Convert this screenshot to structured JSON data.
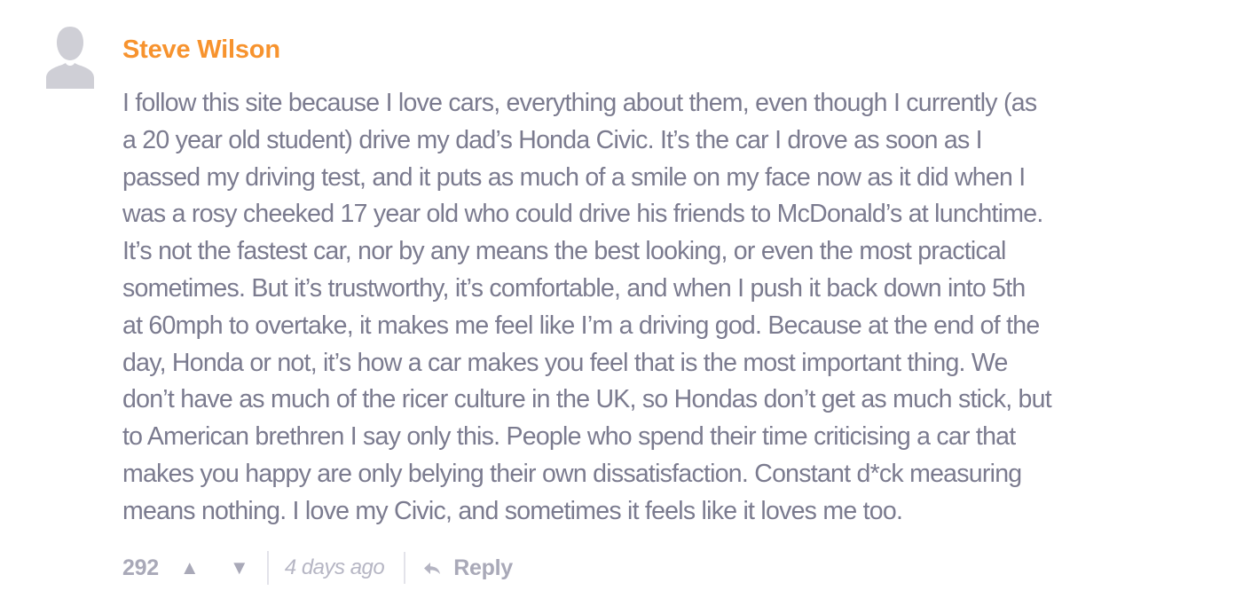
{
  "comment": {
    "author": "Steve Wilson",
    "avatar_icon": "default-user-avatar-icon",
    "body_lines": [
      "I follow this site because I love cars, everything about them, even though I currently (as",
      "a 20 year old student) drive my dad’s Honda Civic. It’s the car I drove as soon as I",
      "passed my driving test, and it puts as much of a smile on my face now as it did when I",
      "was a rosy cheeked 17 year old who could drive his friends to McDonald’s at lunchtime.",
      "It’s not the fastest car, nor by any means the best looking, or even the most practical",
      "sometimes. But it’s trustworthy, it’s comfortable, and when I push it back down into 5th",
      "at 60mph to overtake, it makes me feel like I’m a driving god. Because at the end of the",
      "day, Honda or not, it’s how a car makes you feel that is the most important thing. We",
      "don’t have as much of the ricer culture in the UK, so Hondas don’t get as much stick, but",
      "to American brethren I say only this. People who spend their time criticising a car that",
      "makes you happy are only belying their own dissatisfaction. Constant d*ck measuring",
      "means nothing. I love my Civic, and sometimes it feels like it loves me too."
    ],
    "score": "292",
    "upvote_glyph": "▲",
    "downvote_glyph": "▼",
    "timestamp": "4 days ago",
    "reply_label": "Reply",
    "colors": {
      "author": "#f7932e",
      "body": "#7b7b8f",
      "meta": "#a9a9b8",
      "avatar": "#cfcfd6"
    }
  }
}
